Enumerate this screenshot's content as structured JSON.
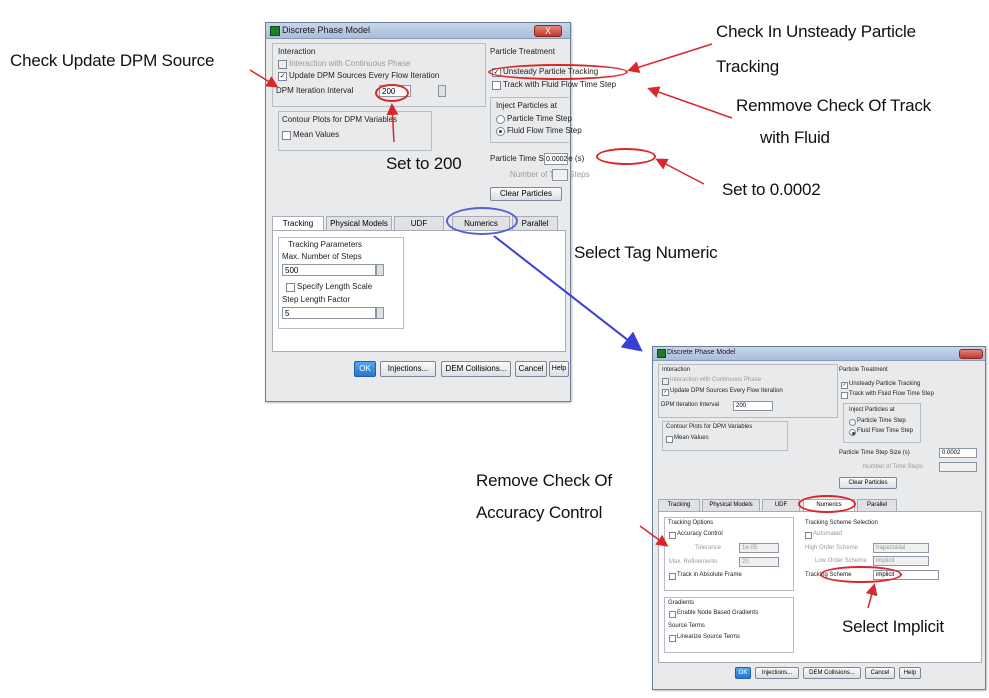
{
  "dialog": {
    "title": "Discrete Phase Model",
    "close_label": "X",
    "interaction": {
      "group_label": "Interaction",
      "continuous_phase_label": "Interaction with Continuous Phase",
      "update_sources_label": "Update DPM Sources Every Flow Iteration",
      "iteration_interval_label": "DPM Iteration Interval",
      "iteration_interval_value": "200"
    },
    "contour": {
      "group_label": "Contour Plots for DPM Variables",
      "mean_values_label": "Mean Values"
    },
    "particle_treatment": {
      "group_label": "Particle Treatment",
      "unsteady_label": "Unsteady Particle Tracking",
      "track_fluid_label": "Track with Fluid Flow Time Step",
      "inject_group_label": "Inject Particles at",
      "particle_time_step_label": "Particle Time Step",
      "fluid_time_step_label": "Fluid Flow Time Step",
      "time_step_size_label": "Particle Time Step Size (s)",
      "time_step_size_value": "0.0002",
      "number_time_steps_label": "Number of Time Steps",
      "clear_particles_label": "Clear Particles"
    },
    "tabs": [
      "Tracking",
      "Physical Models",
      "UDF",
      "Numerics",
      "Parallel"
    ],
    "tracking": {
      "group_label": "Tracking Parameters",
      "max_steps_label": "Max. Number of Steps",
      "max_steps_value": "500",
      "specify_length_label": "Specify Length Scale",
      "step_length_factor_label": "Step Length Factor",
      "step_length_factor_value": "5"
    },
    "buttons": {
      "ok": "OK",
      "injections": "Injections...",
      "dem_collisions": "DEM Collisions...",
      "cancel": "Cancel",
      "help": "Help"
    }
  },
  "dialog2": {
    "title": "Discrete Phase Model",
    "continuous_phase_label": "Interaction with Continuous Phase",
    "update_sources_label": "Update DPM Sources Every Flow Iteration",
    "iteration_interval_label": "DPM Iteration Interval",
    "iteration_interval_value": "200",
    "contour_label": "Contour Plots for DPM Variables",
    "mean_values_label": "Mean Values",
    "interaction_label": "Interaction",
    "particle_treatment_label": "Particle Treatment",
    "unsteady_label": "Unsteady Particle Tracking",
    "track_fluid_label": "Track with Fluid Flow Time Step",
    "inject_label": "Inject Particles at",
    "particle_time_step_label": "Particle Time Step",
    "fluid_time_step_label": "Fluid Flow Time Step",
    "time_step_size_label": "Particle Time Step Size (s)",
    "time_step_size_value": "0.0002",
    "number_time_steps_label": "Number of Time Steps",
    "clear_particles_label": "Clear Particles",
    "tabs": [
      "Tracking",
      "Physical Models",
      "UDF",
      "Numerics",
      "Parallel"
    ],
    "numerics": {
      "tracking_options_label": "Tracking Options",
      "accuracy_control_label": "Accuracy Control",
      "tolerance_label": "Tolerance",
      "tolerance_value": "1e-05",
      "max_refinements_label": "Max. Refinements",
      "max_refinements_value": "20",
      "absolute_frame_label": "Track in Absolute Frame",
      "scheme_selection_label": "Tracking Scheme Selection",
      "automated_label": "Automated",
      "high_order_label": "High Order Scheme",
      "high_order_value": "trapezoidal",
      "low_order_label": "Low Order Scheme",
      "low_order_value": "implicit",
      "tracking_scheme_label": "Tracking Scheme",
      "tracking_scheme_value": "implicit",
      "gradients_label": "Gradients",
      "node_based_label": "Enable Node Based Gradients",
      "source_terms_label": "Source Terms",
      "linearize_label": "Linearize Source Terms"
    },
    "buttons": {
      "ok": "OK",
      "injections": "Injections...",
      "dem_collisions": "DEM Collisions...",
      "cancel": "Cancel",
      "help": "Help"
    }
  },
  "annotations": {
    "check_update": "Check Update DPM Source",
    "check_unsteady_1": "Check In Unsteady Particle",
    "check_unsteady_2": "Tracking",
    "remove_track_1": "Remmove Check Of Track",
    "remove_track_2": "with Fluid",
    "set_200": "Set to 200",
    "set_0002": "Set to 0.0002",
    "select_tag": "Select Tag Numeric",
    "remove_accuracy_1": "Remove Check Of",
    "remove_accuracy_2": "Accuracy Control",
    "select_implicit": "Select Implicit"
  },
  "colors": {
    "annotation_arrow": "#d8282b",
    "tab_pointer_arrow": "#3b3fd8",
    "default_button": "#2777d1"
  }
}
